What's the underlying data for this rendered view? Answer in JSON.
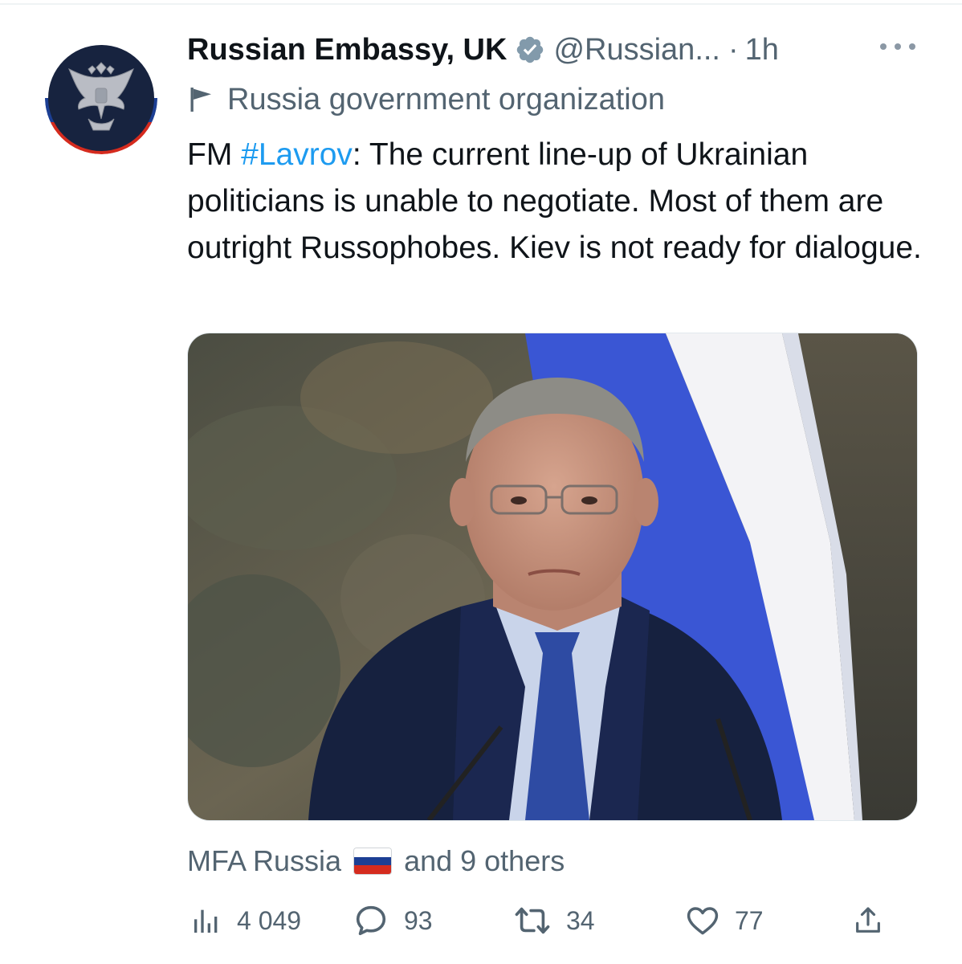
{
  "tweet": {
    "display_name": "Russian Embassy, UK",
    "handle": "@Russian...",
    "separator": "·",
    "time": "1h",
    "account_label": "Russia government organization",
    "text_prefix": "FM ",
    "hashtag": "#Lavrov",
    "text_body": ": The current line-up of Ukrainian politicians is unable to negotiate. Most of them are outright Russophobes. Kiev is not ready for dialogue.",
    "image_alt": "Man at press conference podium in front of Russian flag"
  },
  "liked_by": {
    "name": "MFA Russia",
    "others": "and 9 others"
  },
  "actions": {
    "views": "4 049",
    "replies": "93",
    "retweets": "34",
    "likes": "77"
  },
  "icons": {
    "verified": "verified-badge-icon",
    "more": "more-dots-icon",
    "label": "flag-icon",
    "views": "bar-chart-icon",
    "reply": "speech-bubble-icon",
    "retweet": "retweet-arrows-icon",
    "like": "heart-icon",
    "share": "share-upload-icon"
  },
  "colors": {
    "text": "#0f1419",
    "secondary": "#536471",
    "link": "#1d9bf0",
    "verified": "#829aab"
  }
}
